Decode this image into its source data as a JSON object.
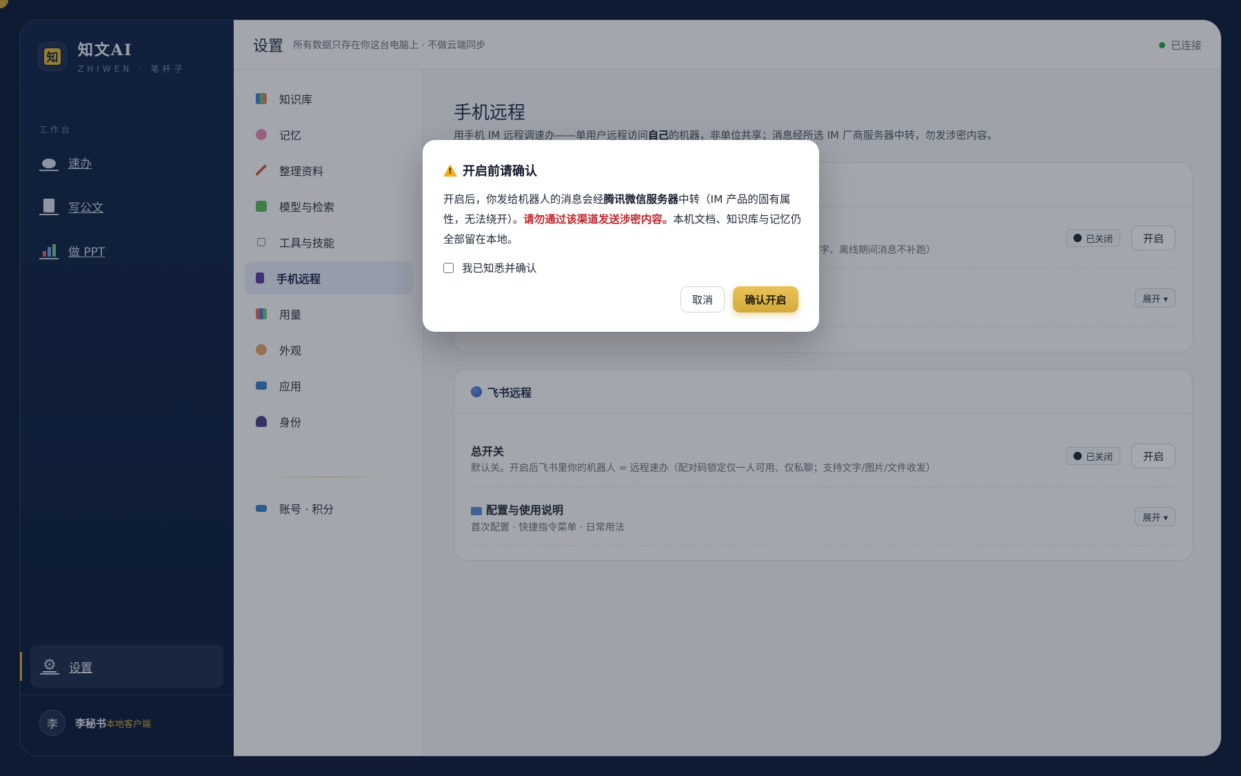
{
  "brand": {
    "name": "知文AI",
    "subtitle": "ZHIWEN · 笔杆子",
    "logo_glyph": "知"
  },
  "sidebar": {
    "section_label": "工作台",
    "items": [
      {
        "label": "速办",
        "icon": "chat-bubble-icon"
      },
      {
        "label": "写公文",
        "icon": "document-icon"
      },
      {
        "label": "做 PPT",
        "icon": "bar-chart-icon"
      }
    ],
    "settings_label": "设置",
    "user": {
      "avatar": "李",
      "name": "李秘书",
      "tag": "本地客户端"
    }
  },
  "topbar": {
    "title": "设置",
    "subtitle": "所有数据只存在你这台电脑上 · 不做云端同步",
    "status": "已连接",
    "status_color": "#22a54a"
  },
  "subnav": {
    "items": [
      {
        "label": "知识库",
        "icon": "books-icon"
      },
      {
        "label": "记忆",
        "icon": "brain-icon"
      },
      {
        "label": "整理资料",
        "icon": "broom-icon"
      },
      {
        "label": "模型与检索",
        "icon": "puzzle-icon"
      },
      {
        "label": "工具与技能",
        "icon": "hexagon-icon"
      },
      {
        "label": "手机远程",
        "icon": "phone-icon",
        "active": true
      },
      {
        "label": "用量",
        "icon": "bar-chart-icon"
      },
      {
        "label": "外观",
        "icon": "palette-icon"
      },
      {
        "label": "应用",
        "icon": "monitor-icon"
      },
      {
        "label": "身份",
        "icon": "person-icon"
      }
    ],
    "account_label": "账号 · 积分"
  },
  "content": {
    "title": "手机远程",
    "desc_prefix": "用手机 IM 远程调速办——单用户远程访问",
    "desc_bold": "自己",
    "desc_suffix": "的机器，非单位共享；消息经所选 IM 厂商服务器中转，勿发涉密内容。",
    "card1": {
      "row1_desc_tail": "仅文字、离线期间消息不补跑）",
      "status": "已关闭",
      "open_label": "开启",
      "expand_label": "展开 ▾"
    },
    "card2": {
      "title": "飞书远程",
      "master_title": "总开关",
      "master_desc": "默认关。开启后飞书里你的机器人 = 远程速办（配对码锁定仅一人可用、仅私聊；支持文字/图片/文件收发）",
      "status": "已关闭",
      "open_label": "开启",
      "guide_title": "配置与使用说明",
      "guide_desc": "首次配置 · 快捷指令菜单 · 日常用法",
      "expand_label": "展开 ▾"
    }
  },
  "modal": {
    "title": "开启前请确认",
    "body_p1": "开启后，你发给机器人的消息会经",
    "body_bold": "腾讯微信服务器",
    "body_p2": "中转（IM 产品的固有属性，无法绕开）。",
    "body_danger": "请勿通过该渠道发送涉密内容。",
    "body_p3": "本机文档、知识库与记忆仍全部留在本地。",
    "checkbox_label": "我已知悉并确认",
    "cancel_label": "取消",
    "confirm_label": "确认开启",
    "accent_color": "#d4a93a",
    "danger_color": "#c0262d"
  }
}
